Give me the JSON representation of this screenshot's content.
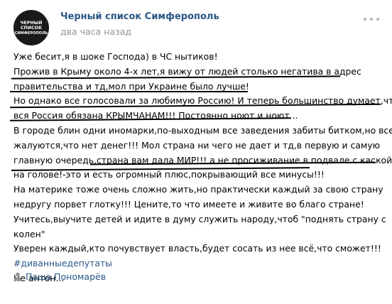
{
  "header": {
    "avatar_lines": [
      "ЧЕРНЫЙ",
      "СПИСОК",
      "СИМФЕРОПОЛЬ"
    ],
    "group_name": "Черный список Симферополь",
    "time": "два часа назад",
    "more_icon": "more-horizontal-icon"
  },
  "post": {
    "lines": [
      "Уже бесит,я в шоке Господа) в ЧС нытиков!",
      "Прожив в Крыму около 4-х лет,я вижу от людей столько негатива в адрес",
      "правительства и тд,мол при Украине было лучше!",
      "Но однако все голосовали за любимую Россию! И теперь большинство думает,что",
      "вся Россия обязана КРЫМЧАНАМ!!! Постоянно ноют и ноют...",
      "В городе блин одни иномарки,по-выходным все заведения забиты битком,но все",
      "жалуются,что нет денег!!! Мол страна ни чего не дает и тд,в первую и самую",
      "главную очередь,страна вам дала МИР!!! а не просиживание в подвале с каской",
      "на голове!-это и есть огромный плюс,покрывающий все минусы!!!",
      "На материке тоже очень сложно жить,но практически каждый за свою страну",
      "недругу порвет глотку!!! Цените,то что имеете и живите во благо стране!",
      "Учитесь,выучите детей и идите в думу служить народу,чтоб \"поднять страну с",
      "колен\"",
      "Уверен каждый,кто почувствует власть,будет сосать из нее всё,что сможет!!!"
    ],
    "hashtag": "#диванныедепутаты",
    "closing": "Не антон..."
  },
  "author": {
    "icon": "user-icon",
    "name": "Паша Пономарёв"
  },
  "colors": {
    "link": "#2a5885",
    "meta": "#939393",
    "text": "#000000"
  }
}
